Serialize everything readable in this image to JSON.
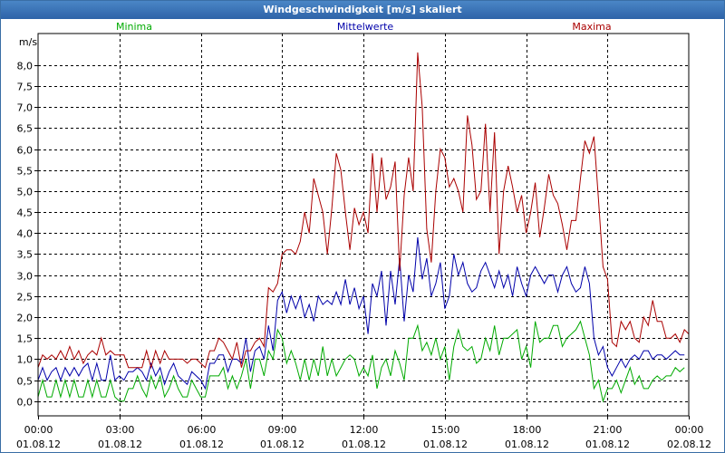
{
  "window": {
    "title": "Windgeschwindigkeit [m/s] skaliert"
  },
  "colors": {
    "min": "#00aa00",
    "mean": "#0000aa",
    "max": "#aa0000",
    "grid": "#000000"
  },
  "chart_data": {
    "type": "line",
    "title": "Windgeschwindigkeit [m/s] skaliert",
    "ylabel": "m/s",
    "xlabel": "",
    "ylim": [
      -0.35,
      8.75
    ],
    "xlim": [
      0,
      24
    ],
    "grid": true,
    "yticks": [
      0.0,
      0.5,
      1.0,
      1.5,
      2.0,
      2.5,
      3.0,
      3.5,
      4.0,
      4.5,
      5.0,
      5.5,
      6.0,
      6.5,
      7.0,
      7.5,
      8.0
    ],
    "ytick_labels": [
      "0,0",
      "0,5",
      "1,0",
      "1,5",
      "2,0",
      "2,5",
      "3,0",
      "3,5",
      "4,0",
      "4,5",
      "5,0",
      "5,5",
      "6,0",
      "6,5",
      "7,0",
      "7,5",
      "8,0"
    ],
    "xticks": [
      {
        "x": 0,
        "time": "00:00",
        "date": "01.08.12"
      },
      {
        "x": 3,
        "time": "03:00",
        "date": "01.08.12"
      },
      {
        "x": 6,
        "time": "06:00",
        "date": "01.08.12"
      },
      {
        "x": 9,
        "time": "09:00",
        "date": "01.08.12"
      },
      {
        "x": 12,
        "time": "12:00",
        "date": "01.08.12"
      },
      {
        "x": 15,
        "time": "15:00",
        "date": "01.08.12"
      },
      {
        "x": 18,
        "time": "18:00",
        "date": "01.08.12"
      },
      {
        "x": 21,
        "time": "21:00",
        "date": "01.08.12"
      },
      {
        "x": 24,
        "time": "00:00",
        "date": "02.08.12"
      }
    ],
    "x_step_hours": 0.1667,
    "series": [
      {
        "name": "Minima",
        "color": "#00aa00",
        "values": [
          0.1,
          0.5,
          0.1,
          0.1,
          0.5,
          0.1,
          0.5,
          0.1,
          0.5,
          0.1,
          0.1,
          0.5,
          0.1,
          0.5,
          0.1,
          0.1,
          0.5,
          0.1,
          0.0,
          0.0,
          0.3,
          0.3,
          0.6,
          0.3,
          0.1,
          0.6,
          0.3,
          0.6,
          0.1,
          0.3,
          0.6,
          0.3,
          0.1,
          0.1,
          0.5,
          0.3,
          0.1,
          0.1,
          0.6,
          0.6,
          0.6,
          0.8,
          0.3,
          0.6,
          0.3,
          0.6,
          1.0,
          0.3,
          1.0,
          1.0,
          0.6,
          1.2,
          1.0,
          1.7,
          1.5,
          0.9,
          1.2,
          0.9,
          0.5,
          1.0,
          0.5,
          1.0,
          0.6,
          1.3,
          0.6,
          1.0,
          0.6,
          0.8,
          1.0,
          1.1,
          1.0,
          0.6,
          0.8,
          0.6,
          1.1,
          0.3,
          0.8,
          1.0,
          0.6,
          1.2,
          0.9,
          0.5,
          1.5,
          1.5,
          1.8,
          1.2,
          1.4,
          1.1,
          1.5,
          1.0,
          1.3,
          0.5,
          1.3,
          1.7,
          1.3,
          1.2,
          1.3,
          0.9,
          1.0,
          1.5,
          1.2,
          1.8,
          1.1,
          1.5,
          1.5,
          1.6,
          1.7,
          1.0,
          1.3,
          0.8,
          1.9,
          1.4,
          1.5,
          1.5,
          1.8,
          1.8,
          1.3,
          1.5,
          1.6,
          1.7,
          1.9,
          1.5,
          1.1,
          0.3,
          0.5,
          0.0,
          0.3,
          0.3,
          0.5,
          0.2,
          0.5,
          0.8,
          0.4,
          0.6,
          0.3,
          0.3,
          0.5,
          0.6,
          0.5,
          0.6,
          0.6,
          0.8,
          0.7,
          0.8
        ]
      },
      {
        "name": "Mittelwerte",
        "color": "#0000aa",
        "values": [
          0.5,
          0.8,
          0.5,
          0.7,
          0.8,
          0.5,
          0.8,
          0.6,
          0.8,
          0.6,
          0.8,
          0.9,
          0.5,
          0.9,
          0.5,
          0.5,
          1.1,
          0.5,
          0.6,
          0.5,
          0.7,
          0.7,
          0.8,
          0.7,
          0.5,
          0.9,
          0.6,
          0.8,
          0.4,
          0.7,
          0.9,
          0.6,
          0.5,
          0.4,
          0.7,
          0.6,
          0.5,
          0.3,
          0.9,
          0.9,
          1.1,
          1.1,
          0.7,
          1.0,
          1.0,
          0.9,
          1.5,
          0.7,
          1.2,
          1.3,
          1.0,
          1.8,
          1.2,
          2.4,
          2.6,
          2.1,
          2.5,
          2.2,
          2.5,
          2.0,
          2.3,
          1.9,
          2.5,
          2.3,
          2.4,
          2.3,
          2.6,
          2.3,
          2.9,
          2.3,
          2.7,
          2.2,
          2.5,
          1.6,
          2.8,
          2.5,
          3.1,
          1.8,
          3.1,
          2.3,
          3.4,
          1.9,
          3.0,
          2.6,
          3.9,
          2.9,
          3.4,
          2.5,
          2.8,
          3.3,
          2.2,
          2.5,
          3.5,
          3.0,
          3.3,
          2.8,
          2.6,
          2.7,
          3.1,
          3.3,
          3.0,
          2.7,
          3.1,
          2.7,
          3.0,
          2.5,
          3.2,
          2.8,
          2.5,
          3.0,
          3.2,
          3.0,
          2.8,
          3.0,
          3.0,
          2.6,
          3.0,
          3.2,
          2.8,
          2.6,
          2.7,
          3.2,
          2.8,
          1.5,
          1.1,
          1.3,
          0.8,
          0.6,
          0.8,
          1.0,
          0.8,
          1.0,
          1.1,
          1.0,
          1.2,
          1.2,
          1.0,
          1.1,
          1.1,
          1.0,
          1.1,
          1.2,
          1.1,
          1.1
        ]
      },
      {
        "name": "Maxima",
        "color": "#aa0000",
        "values": [
          0.8,
          1.1,
          1.0,
          1.1,
          1.0,
          1.2,
          1.0,
          1.3,
          1.0,
          1.2,
          0.9,
          1.1,
          1.2,
          1.1,
          1.5,
          1.1,
          1.2,
          1.1,
          1.1,
          1.1,
          0.8,
          0.8,
          0.8,
          0.8,
          1.2,
          0.8,
          1.2,
          0.9,
          1.2,
          1.0,
          1.0,
          1.0,
          1.0,
          0.9,
          1.0,
          1.0,
          0.9,
          0.8,
          1.2,
          1.2,
          1.5,
          1.4,
          1.2,
          1.0,
          1.4,
          0.8,
          1.2,
          1.2,
          1.4,
          1.5,
          1.3,
          2.7,
          2.6,
          2.8,
          3.5,
          3.6,
          3.6,
          3.5,
          3.8,
          4.5,
          4.0,
          5.3,
          4.9,
          4.5,
          3.5,
          4.6,
          5.9,
          5.5,
          4.5,
          3.6,
          4.6,
          4.2,
          4.5,
          4.0,
          5.9,
          4.5,
          5.8,
          4.8,
          5.1,
          5.7,
          3.1,
          4.9,
          5.8,
          5.0,
          8.3,
          7.0,
          4.1,
          3.3,
          5.0,
          6.0,
          5.8,
          5.1,
          5.3,
          5.0,
          4.5,
          6.8,
          6.1,
          4.8,
          5.0,
          6.6,
          4.5,
          6.4,
          3.5,
          5.0,
          5.6,
          5.1,
          4.5,
          4.9,
          4.0,
          4.5,
          5.2,
          3.9,
          4.6,
          5.4,
          4.9,
          4.7,
          4.2,
          3.6,
          4.3,
          4.3,
          5.3,
          6.2,
          5.9,
          6.3,
          4.8,
          3.2,
          2.9,
          1.4,
          1.3,
          1.9,
          1.7,
          1.9,
          1.5,
          1.4,
          2.0,
          1.8,
          2.4,
          1.9,
          1.9,
          1.5,
          1.5,
          1.6,
          1.4,
          1.7,
          1.6,
          1.5
        ]
      }
    ]
  }
}
